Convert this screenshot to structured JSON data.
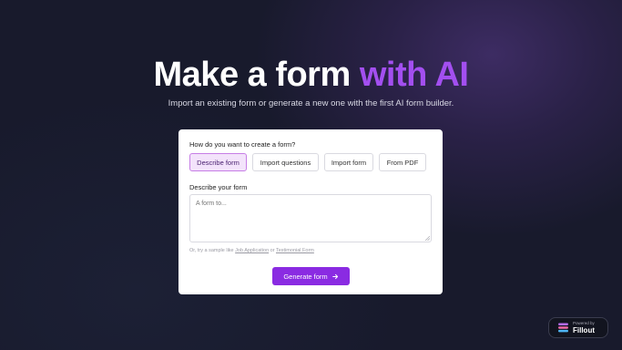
{
  "hero": {
    "title_main": "Make a form ",
    "title_accent": "with AI",
    "subtitle": "Import an existing form or generate a new one with the first AI form builder."
  },
  "form": {
    "question_label": "How do you want to create a form?",
    "options": [
      {
        "label": "Describe form",
        "selected": true
      },
      {
        "label": "Import questions",
        "selected": false
      },
      {
        "label": "Import form",
        "selected": false
      },
      {
        "label": "From PDF",
        "selected": false
      }
    ],
    "describe_label": "Describe your form",
    "textarea_placeholder": "A form to...",
    "sample_prefix": "Or, try a sample like ",
    "sample_link_1": "Job Application",
    "sample_or": " or ",
    "sample_link_2": "Testimonial Form",
    "generate_label": "Generate form"
  },
  "badge": {
    "powered_by": "Powered by",
    "brand": "Fillout"
  },
  "colors": {
    "accent": "#a34ff0",
    "button": "#8a2be2",
    "selected_bg": "#f3e3fb",
    "background": "#181a2c"
  }
}
